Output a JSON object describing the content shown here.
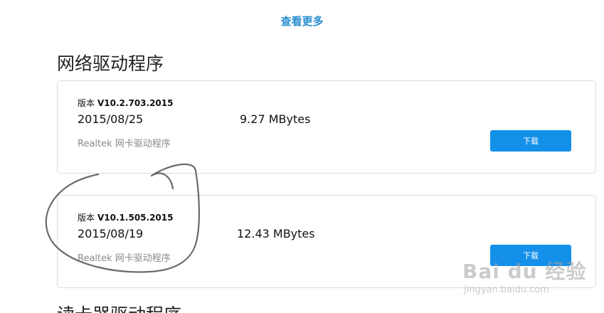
{
  "header": {
    "see_more_label": "查看更多"
  },
  "section": {
    "title": "网络驱动程序",
    "next_title": "读卡器驱动程序"
  },
  "drivers": [
    {
      "version_prefix": "版本",
      "version": "V10.2.703.2015",
      "date": "2015/08/25",
      "size": "9.27 MBytes",
      "description": "Realtek 网卡驱动程序",
      "download_label": "下载"
    },
    {
      "version_prefix": "版本",
      "version": "V10.1.505.2015",
      "date": "2015/08/19",
      "size": "12.43 MBytes",
      "description": "Realtek 网卡驱动程序",
      "download_label": "下载"
    }
  ],
  "watermark": {
    "logo": "Bai du 经验",
    "url": "jingyan.baidu.com"
  },
  "colors": {
    "accent": "#1490ea",
    "link": "#2a8fd0",
    "border": "#dcdcdc",
    "muted": "#8a8a8a"
  }
}
